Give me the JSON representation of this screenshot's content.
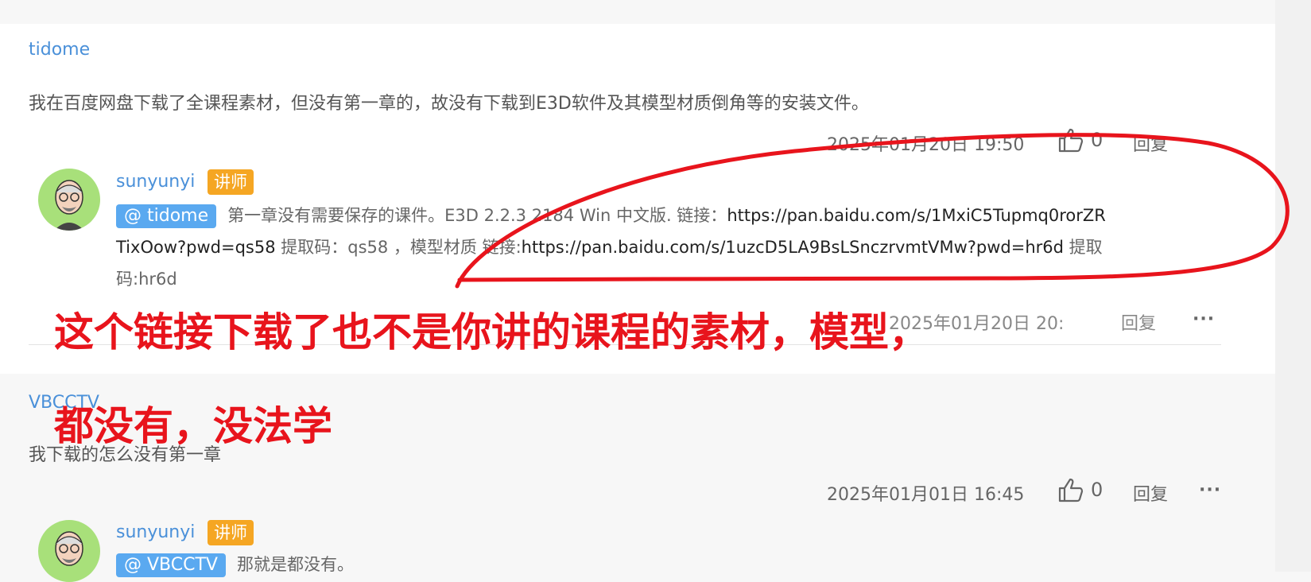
{
  "comment1": {
    "author": "tidome",
    "text": "我在百度网盘下载了全课程素材，但没有第一章的，故没有下载到E3D软件及其模型材质倒角等的安装文件。",
    "timestamp": "2025年01月20日 19:50",
    "likes": "0",
    "reply_label": "回复",
    "more": "···"
  },
  "reply1": {
    "author": "sunyunyi",
    "badge": "讲师",
    "mention": "@ tidome",
    "line1_text": "第一章没有需要保存的课件。E3D 2.2.3 2184 Win 中文版. 链接：",
    "line1_link": "https://pan.baidu.com/s/1MxiC5Tupmq0rorZR",
    "line2_link_end": "TixOow?pwd=qs58",
    "line2_text": " 提取码：qs58 ，模型材质 链接:",
    "line2_link2": "https://pan.baidu.com/s/1uzcD5LA9BsLSnczrvmtVMw?pwd=hr6d",
    "line2_text2": " 提取",
    "line3_text": "码:hr6d",
    "timestamp": "2025年01月20日 20:",
    "reply_label": "回复",
    "more": "···"
  },
  "comment2": {
    "author": "VBCCTV",
    "text": "我下载的怎么没有第一章",
    "timestamp": "2025年01月01日 16:45",
    "likes": "0",
    "reply_label": "回复",
    "more": "···"
  },
  "reply2": {
    "author": "sunyunyi",
    "badge": "讲师",
    "mention": "@ VBCCTV",
    "text": "那就是都没有。"
  },
  "annotation": {
    "line1": "这个链接下载了也不是你讲的课程的素材，模型，",
    "line2": "都没有，没法学",
    "color": "#e8141c"
  },
  "colors": {
    "accent_blue": "#4a90d9",
    "mention_bg": "#5aa9f0",
    "badge_orange": "#f5a623",
    "avatar_green": "#a8e07a"
  }
}
